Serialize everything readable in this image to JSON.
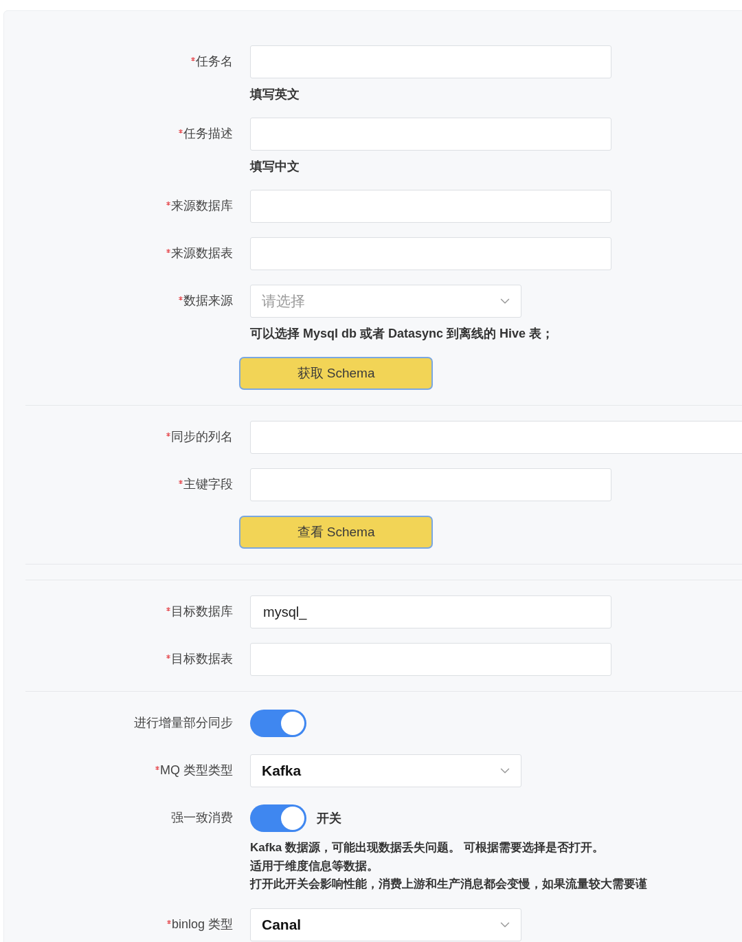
{
  "sections": [
    {
      "fields": [
        {
          "kind": "input",
          "label": "任务名",
          "required": true,
          "hint": "填写英文"
        },
        {
          "kind": "input",
          "label": "任务描述",
          "required": true,
          "hint": "填写中文"
        },
        {
          "kind": "input",
          "label": "来源数据库",
          "required": true
        },
        {
          "kind": "input",
          "label": "来源数据表",
          "required": true
        },
        {
          "kind": "select",
          "label": "数据来源",
          "required": true,
          "placeholder": "请选择",
          "hint": "可以选择 Mysql db 或者 Datasync 到离线的 Hive 表；"
        },
        {
          "kind": "button",
          "text": "获取 Schema"
        }
      ]
    },
    {
      "fields": [
        {
          "kind": "wide_input",
          "label": "同步的列名",
          "required": true
        },
        {
          "kind": "input",
          "label": "主键字段",
          "required": true
        },
        {
          "kind": "button",
          "text": "查看 Schema"
        }
      ]
    },
    {
      "fields": [
        {
          "kind": "input",
          "label": "目标数据库",
          "required": true,
          "value": "mysql_"
        },
        {
          "kind": "input",
          "label": "目标数据表",
          "required": true
        }
      ]
    },
    {
      "fields": [
        {
          "kind": "toggle",
          "label": "进行增量部分同步",
          "required": false,
          "on": true
        },
        {
          "kind": "select",
          "label": "MQ 类型类型",
          "required": true,
          "value": "Kafka"
        },
        {
          "kind": "toggle",
          "label": "强一致消费",
          "required": false,
          "on": true,
          "text": "开关",
          "notes": [
            "Kafka 数据源，可能出现数据丢失问题。 可根据需要选择是否打开。",
            "适用于维度信息等数据。",
            "打开此开关会影响性能，消费上游和生产消息都会变慢，如果流量较大需要谨"
          ]
        },
        {
          "kind": "select",
          "label": "binlog 类型",
          "required": true,
          "value": "Canal"
        }
      ]
    }
  ]
}
